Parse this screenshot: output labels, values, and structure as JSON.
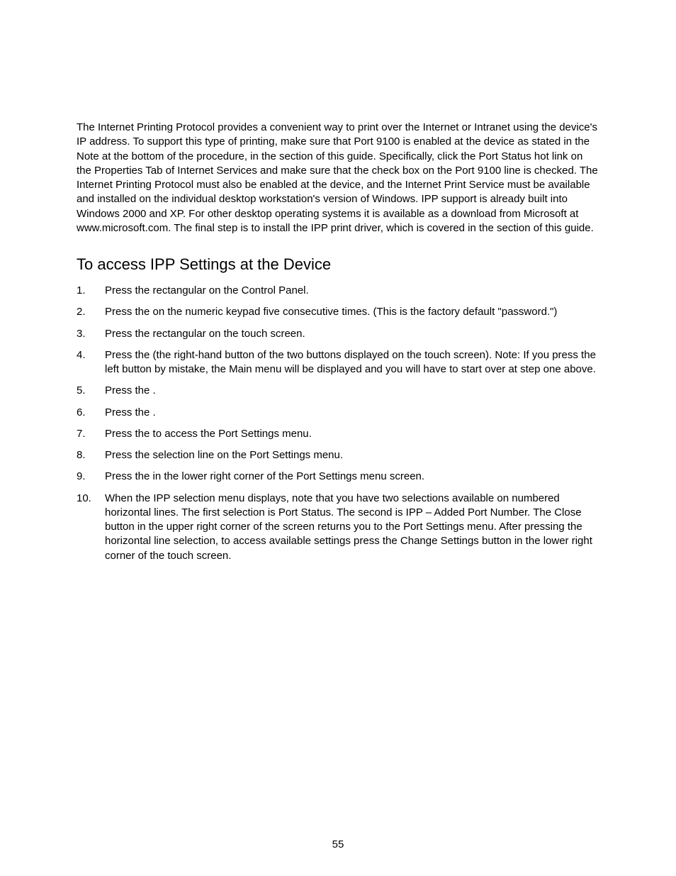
{
  "intro": "The Internet Printing Protocol provides a convenient way to print over the Internet or Intranet using the device's IP address.  To support this type of printing, make sure that Port 9100 is enabled at the device as stated in the Note at the bottom of the                                       procedure, in the                                      section of this guide.  Specifically, click the Port Status hot link on the Properties Tab of Internet Services and make sure that the check box on the Port 9100 line is checked.  The Internet Printing Protocol must also be enabled at the device, and the Internet Print Service must be available and installed on the individual desktop workstation's version of Windows.  IPP support is already built into Windows 2000 and XP.  For other desktop operating systems it is available as a download from Microsoft at www.microsoft.com.  The final step is to install the IPP print driver, which is covered in the                           section of this guide.",
  "heading": "To access IPP Settings at the Device",
  "steps": [
    {
      "num": "1.",
      "text": "Press the rectangular                                     on the Control Panel."
    },
    {
      "num": "2.",
      "text": "Press the               on the numeric keypad five consecutive times.  (This is the factory default \"password.\")"
    },
    {
      "num": "3.",
      "text": "Press the rectangular                                 on the touch screen."
    },
    {
      "num": "4.",
      "text": "Press the                                              (the right-hand button of the two buttons displayed on the touch screen).  Note:  If you press the left button by mistake, the Main menu will be displayed and you will have to start over at step one above."
    },
    {
      "num": "5.",
      "text": "Press the                                              ."
    },
    {
      "num": "6.",
      "text": "Press the                                             ."
    },
    {
      "num": "7.",
      "text": "Press the                                     to access the Port Settings menu."
    },
    {
      "num": "8.",
      "text": "Press the        selection line on the Port Settings menu."
    },
    {
      "num": "9.",
      "text": "Press the                                              in the lower right corner of the Port Settings menu screen."
    },
    {
      "num": "10.",
      "text": "When the IPP selection menu displays, note that you have two selections available on numbered horizontal lines.  The first selection is Port Status.  The second is IPP – Added Port Number.  The Close button in the upper right corner of the screen returns you to the Port Settings menu.  After pressing the horizontal line selection, to access available settings press the Change Settings button in the lower right corner of the touch screen."
    }
  ],
  "pageNumber": "55"
}
